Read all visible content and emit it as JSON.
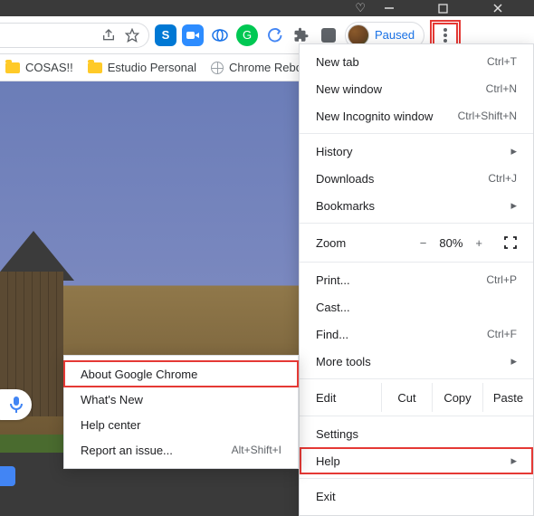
{
  "profile": {
    "status": "Paused"
  },
  "bookmarks": [
    {
      "label": "COSAS!!",
      "type": "folder"
    },
    {
      "label": "Estudio Personal",
      "type": "folder"
    },
    {
      "label": "Chrome Reboot",
      "type": "link"
    }
  ],
  "menu": {
    "new_tab": {
      "label": "New tab",
      "shortcut": "Ctrl+T"
    },
    "new_window": {
      "label": "New window",
      "shortcut": "Ctrl+N"
    },
    "new_incognito": {
      "label": "New Incognito window",
      "shortcut": "Ctrl+Shift+N"
    },
    "history": {
      "label": "History"
    },
    "downloads": {
      "label": "Downloads",
      "shortcut": "Ctrl+J"
    },
    "bookmarks": {
      "label": "Bookmarks"
    },
    "zoom": {
      "label": "Zoom",
      "minus": "−",
      "value": "80%",
      "plus": "+"
    },
    "print": {
      "label": "Print...",
      "shortcut": "Ctrl+P"
    },
    "cast": {
      "label": "Cast..."
    },
    "find": {
      "label": "Find...",
      "shortcut": "Ctrl+F"
    },
    "more_tools": {
      "label": "More tools"
    },
    "edit": {
      "label": "Edit",
      "cut": "Cut",
      "copy": "Copy",
      "paste": "Paste"
    },
    "settings": {
      "label": "Settings"
    },
    "help": {
      "label": "Help"
    },
    "exit": {
      "label": "Exit"
    }
  },
  "help_submenu": {
    "about": {
      "label": "About Google Chrome"
    },
    "whats_new": {
      "label": "What's New"
    },
    "help_center": {
      "label": "Help center"
    },
    "report": {
      "label": "Report an issue...",
      "shortcut": "Alt+Shift+I"
    }
  }
}
